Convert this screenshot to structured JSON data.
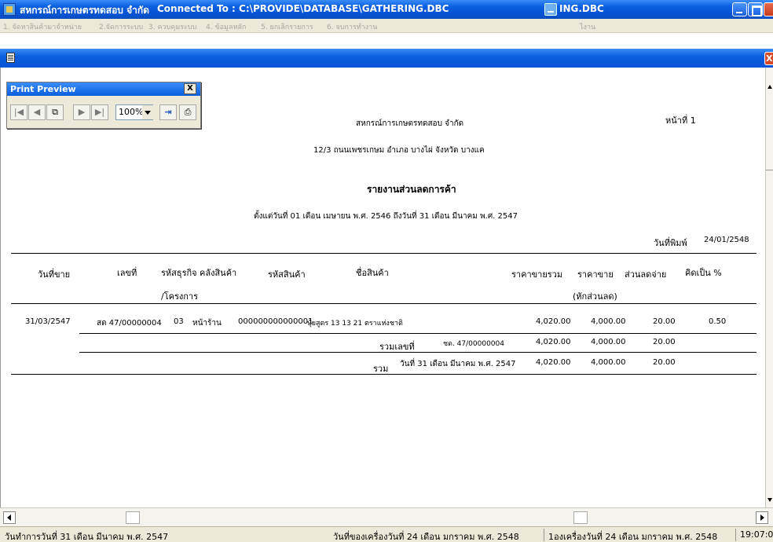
{
  "titlebar": {
    "app_name": "สหกรณ์การเกษตรทดสอบ จำกัด",
    "connection": "Connected  To  : C:\\PROVIDE\\DATABASE\\GATHERING.DBC",
    "secondary_title": "ING.DBC"
  },
  "menubar": {
    "items": [
      "1. จัดหาสินค้ามาจำหน่าย",
      "2.จัดการระบบ",
      "3. ควบคุมระบบ",
      "4. ข้อมูลหลัก",
      "5. ยกเลิกรายการ",
      "6. จบการทำงาน"
    ],
    "right_label": "ไงาน"
  },
  "print_preview": {
    "title": "Print Preview",
    "zoom": "100%",
    "close_label": "X"
  },
  "child_window": {
    "close_label": "X"
  },
  "report": {
    "company": "สหกรณ์การเกษตรทดสอบ จำกัด",
    "address": "12/3 ถนนเพชรเกษม อำเภอ  บางไผ่ จังหวัด บางแค",
    "page_label": "หน้าที่  1",
    "title": "รายงานส่วนลดการค้า",
    "period": "ตั้งแต่วันที่ 01 เดือน เมษายน  พ.ศ. 2546  ถึงวันที่ 31  เดือน  มีนาคม  พ.ศ. 2547",
    "print_date_label": "วันที่พิมพ์",
    "print_date": "24/01/2548",
    "headers": {
      "sale_date": "วันที่ขาย",
      "doc_no": "เลขที่",
      "business_code": "รหัสธุรกิจ",
      "business_code_2": "/โครงการ",
      "warehouse": "คลังสินค้า",
      "product_code": "รหัสสินค้า",
      "product_name": "ชื่อสินค้า",
      "total_price": "ราคาขายรวม",
      "net_price": "ราคาขาย",
      "net_price_2": "(หักส่วนลด)",
      "discount": "ส่วนลดจ่าย",
      "percent": "คิดเป็น %"
    },
    "row": {
      "sale_date": "31/03/2547",
      "doc_no": "สด 47/00000004",
      "business_code": "03",
      "warehouse": "หน้าร้าน",
      "product_code": "000000000000001",
      "product_name": "ปุ๋ยสูตร 13 13 21 ตราแห่งชาติ",
      "total_price": "4,020.00",
      "net_price": "4,000.00",
      "discount": "20.00",
      "percent": "0.50"
    },
    "subtotal_doc": {
      "label": "รวมเลขที่",
      "doc": "ชด. 47/00000004",
      "total_price": "4,020.00",
      "net_price": "4,000.00",
      "discount": "20.00"
    },
    "subtotal_date": {
      "label": "รวม",
      "date_text": "วันที่ 31 เดือน มีนาคม พ.ศ. 2547",
      "total_price": "4,020.00",
      "net_price": "4,000.00",
      "discount": "20.00"
    }
  },
  "statusbar": {
    "work_date": "วันทำการวันที่ 31 เดือน มีนาคม  พ.ศ. 2547",
    "machine_date": "วันที่ของเครื่องวันที่ 24 เดือน มกราคม  พ.ศ. 2548",
    "machine_date_2": "1องเครื่องวันที่ 24 เดือน มกราคม  พ.ศ. 2548",
    "time": "19:07:0"
  },
  "colors": {
    "titlebar": "#0a5fe0",
    "status_bg": "#ece9d8",
    "close_red": "#d84a28"
  }
}
